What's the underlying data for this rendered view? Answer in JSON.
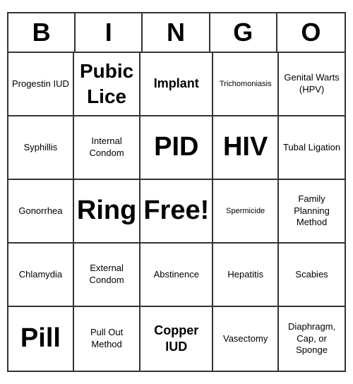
{
  "header": {
    "letters": [
      "B",
      "I",
      "N",
      "G",
      "O"
    ]
  },
  "cells": [
    {
      "text": "Progestin IUD",
      "size": "normal"
    },
    {
      "text": "Pubic Lice",
      "size": "large"
    },
    {
      "text": "Implant",
      "size": "medium"
    },
    {
      "text": "Trichomoniasis",
      "size": "small"
    },
    {
      "text": "Genital Warts (HPV)",
      "size": "normal"
    },
    {
      "text": "Syphillis",
      "size": "normal"
    },
    {
      "text": "Internal Condom",
      "size": "normal"
    },
    {
      "text": "PID",
      "size": "xlarge"
    },
    {
      "text": "HIV",
      "size": "xlarge"
    },
    {
      "text": "Tubal Ligation",
      "size": "normal"
    },
    {
      "text": "Gonorrhea",
      "size": "normal"
    },
    {
      "text": "Ring",
      "size": "xlarge"
    },
    {
      "text": "Free!",
      "size": "xlarge"
    },
    {
      "text": "Spermicide",
      "size": "small"
    },
    {
      "text": "Family Planning Method",
      "size": "normal"
    },
    {
      "text": "Chlamydia",
      "size": "normal"
    },
    {
      "text": "External Condom",
      "size": "normal"
    },
    {
      "text": "Abstinence",
      "size": "normal"
    },
    {
      "text": "Hepatitis",
      "size": "normal"
    },
    {
      "text": "Scabies",
      "size": "normal"
    },
    {
      "text": "Pill",
      "size": "xlarge"
    },
    {
      "text": "Pull Out Method",
      "size": "normal"
    },
    {
      "text": "Copper IUD",
      "size": "medium"
    },
    {
      "text": "Vasectomy",
      "size": "normal"
    },
    {
      "text": "Diaphragm, Cap, or Sponge",
      "size": "normal"
    }
  ]
}
